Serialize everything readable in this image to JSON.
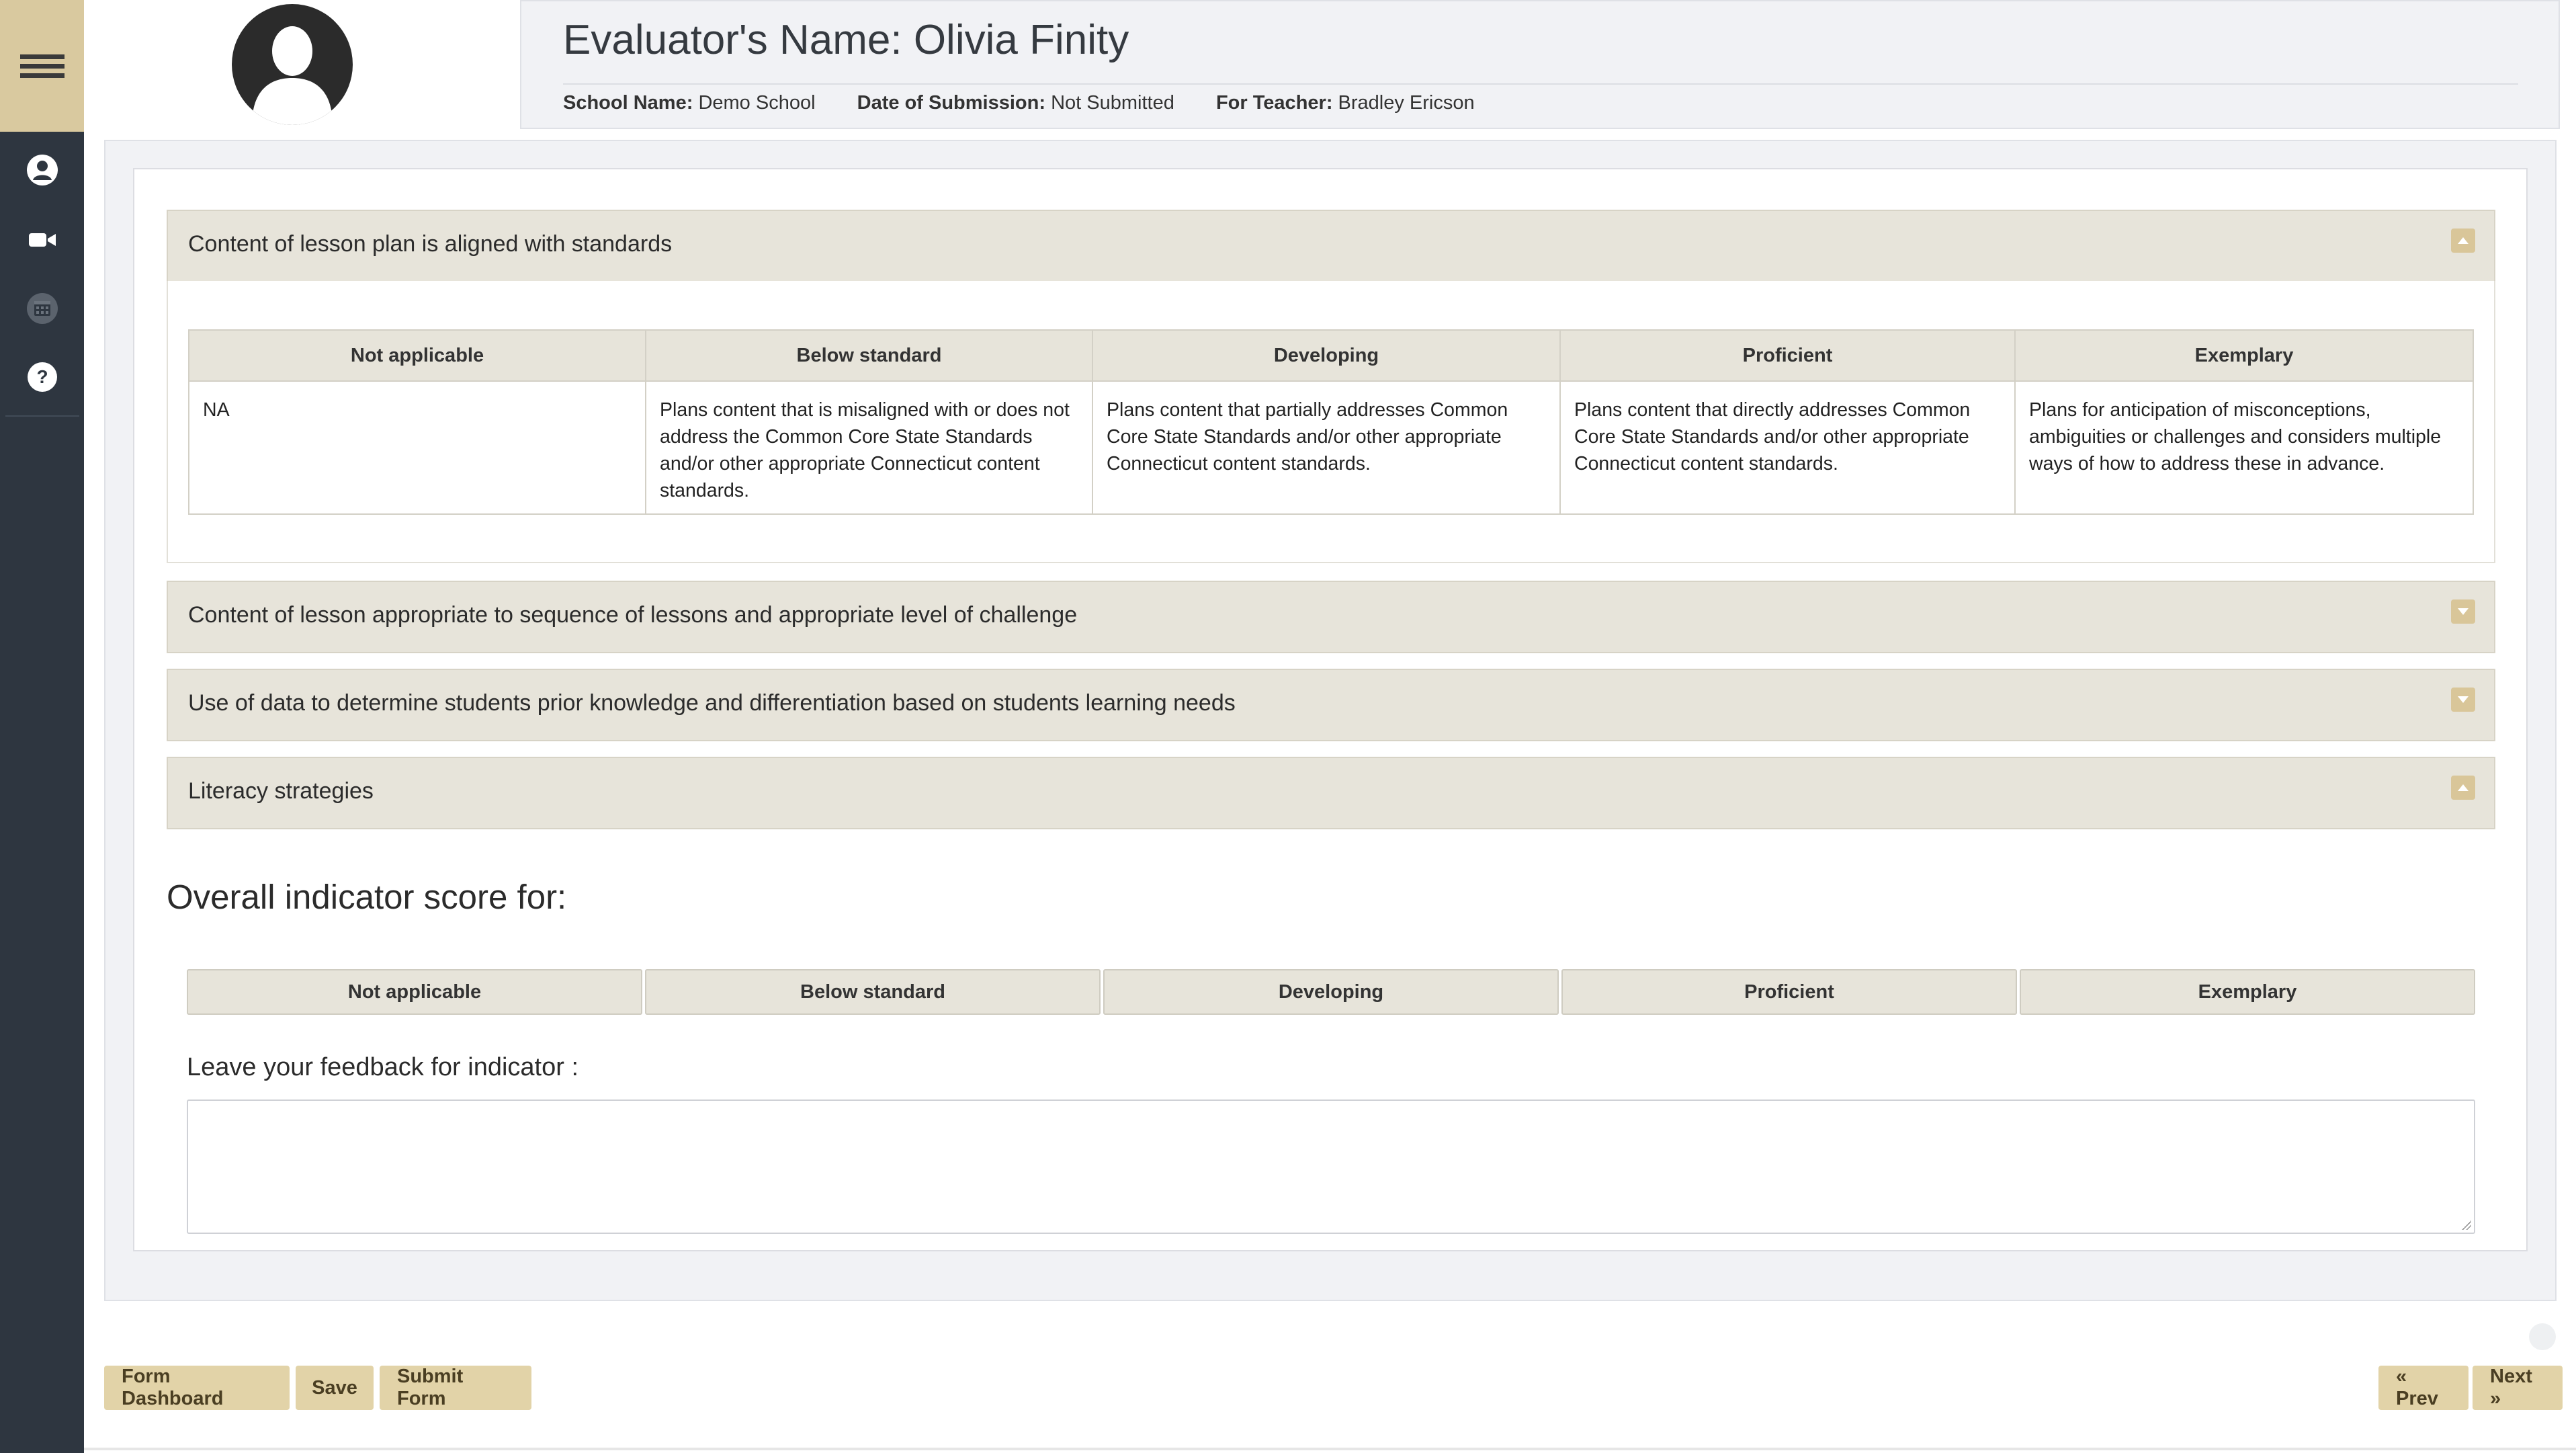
{
  "sidebar": {
    "menu_icon": "hamburger-menu-icon",
    "icons": [
      "user-circle-icon",
      "video-camera-icon",
      "calendar-icon",
      "help-circle-icon"
    ]
  },
  "header": {
    "title": "Evaluator's Name: Olivia Finity",
    "school_label": "School Name:",
    "school_value": "Demo School",
    "date_label": "Date of Submission:",
    "date_value": "Not Submitted",
    "teacher_label": "For Teacher:",
    "teacher_value": "Bradley Ericson"
  },
  "accordions": [
    {
      "title": "Content of lesson plan is aligned with standards",
      "state": "expanded"
    },
    {
      "title": "Content of lesson appropriate to sequence of lessons and appropriate level of challenge",
      "state": "collapsed"
    },
    {
      "title": "Use of data to determine students prior knowledge and differentiation based on students learning needs",
      "state": "collapsed"
    },
    {
      "title": "Literacy strategies",
      "state": "expanded"
    }
  ],
  "rubric": {
    "columns": [
      {
        "head": "Not applicable",
        "body": "NA"
      },
      {
        "head": "Below standard",
        "body": "Plans content that is misaligned with or does not address the Common Core State Standards and/or other appropriate Connecticut content standards."
      },
      {
        "head": "Developing",
        "body": "Plans content that partially addresses Common Core State Standards and/or other appropriate Connecticut content standards."
      },
      {
        "head": "Proficient",
        "body": "Plans content that directly addresses Common Core State Standards and/or other appropriate Connecticut content standards."
      },
      {
        "head": "Exemplary",
        "body": "Plans for anticipation of misconceptions, ambiguities or challenges and considers multiple ways of how to address these in advance."
      }
    ]
  },
  "overall": {
    "title": "Overall indicator score for:",
    "options": [
      "Not applicable",
      "Below standard",
      "Developing",
      "Proficient",
      "Exemplary"
    ]
  },
  "feedback": {
    "label": "Leave your feedback for indicator :",
    "value": ""
  },
  "footer": {
    "form_dashboard": "Form Dashboard",
    "save": "Save",
    "submit": "Submit Form",
    "prev": "« Prev",
    "next": "Next »"
  },
  "colors": {
    "sidebar": "#2e3640",
    "accent": "#d9c99f",
    "panel_head": "#e7e4da",
    "button": "#e2d3a8"
  }
}
